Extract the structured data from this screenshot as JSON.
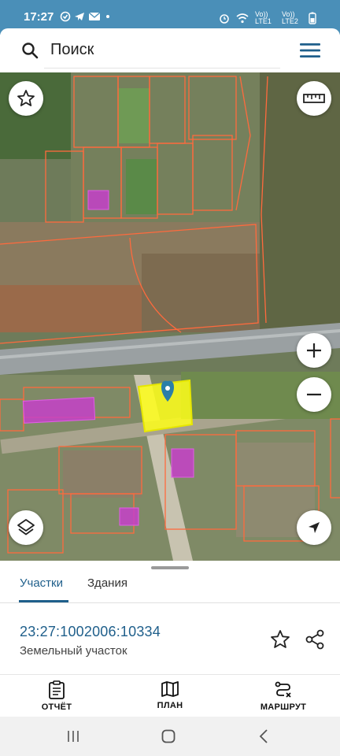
{
  "status_bar": {
    "time": "17:27",
    "sim1": "Vo)) LTE1",
    "sim2": "Vo)) LTE2",
    "notif_icons": [
      "check-circle-icon",
      "telegram-icon",
      "mail-icon",
      "dot-icon"
    ],
    "right_icons": [
      "alarm-icon",
      "wifi-icon",
      "signal-icon",
      "battery-icon"
    ]
  },
  "search": {
    "placeholder": "Поиск"
  },
  "map": {
    "highlight_color": "#ffff1a",
    "boundary_color": "#ff6a3d",
    "building_color": "#c640c9",
    "buttons": [
      "favorite-star-icon",
      "ruler-icon",
      "zoom-in-icon",
      "zoom-out-icon",
      "layers-icon",
      "locate-arrow-icon"
    ]
  },
  "sheet": {
    "tabs": [
      {
        "label": "Участки",
        "active": true
      },
      {
        "label": "Здания",
        "active": false
      }
    ],
    "cadastral_number": "23:27:1002006:10334",
    "object_type": "Земельный участок",
    "actions": [
      {
        "label": "ОТЧЁТ",
        "icon": "report-icon"
      },
      {
        "label": "ПЛАН",
        "icon": "map-plan-icon"
      },
      {
        "label": "МАРШРУТ",
        "icon": "route-icon"
      }
    ]
  },
  "system_nav": [
    "recent-apps-icon",
    "home-icon",
    "back-icon"
  ]
}
